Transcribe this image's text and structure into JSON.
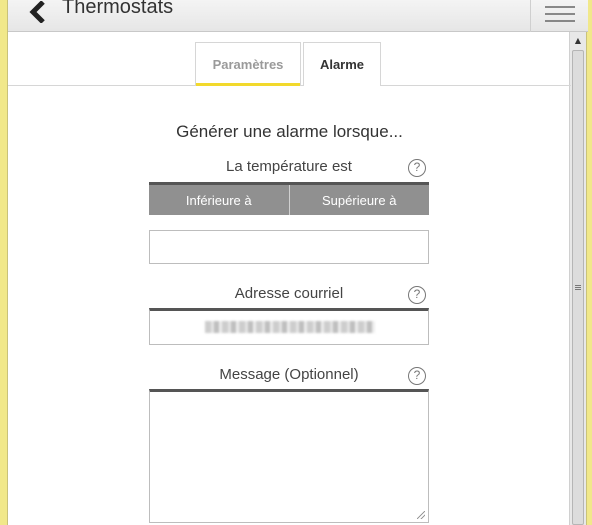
{
  "header": {
    "title": "Thermostats",
    "back_icon": "chevron-left-icon",
    "menu_icon": "hamburger-menu-icon"
  },
  "tabs": [
    {
      "label": "Paramètres",
      "active": false
    },
    {
      "label": "Alarme",
      "active": true
    }
  ],
  "form": {
    "heading": "Générer une alarme lorsque...",
    "temperature": {
      "label": "La température est",
      "options": [
        "Inférieure à",
        "Supérieure à"
      ],
      "value": ""
    },
    "email": {
      "label": "Adresse courriel",
      "value": ""
    },
    "message": {
      "label": "Message (Optionnel)",
      "value": ""
    },
    "help_glyph": "?"
  },
  "colors": {
    "accent": "#f2d92c",
    "segment_bg": "#909090",
    "frame": "#f1e88a"
  }
}
